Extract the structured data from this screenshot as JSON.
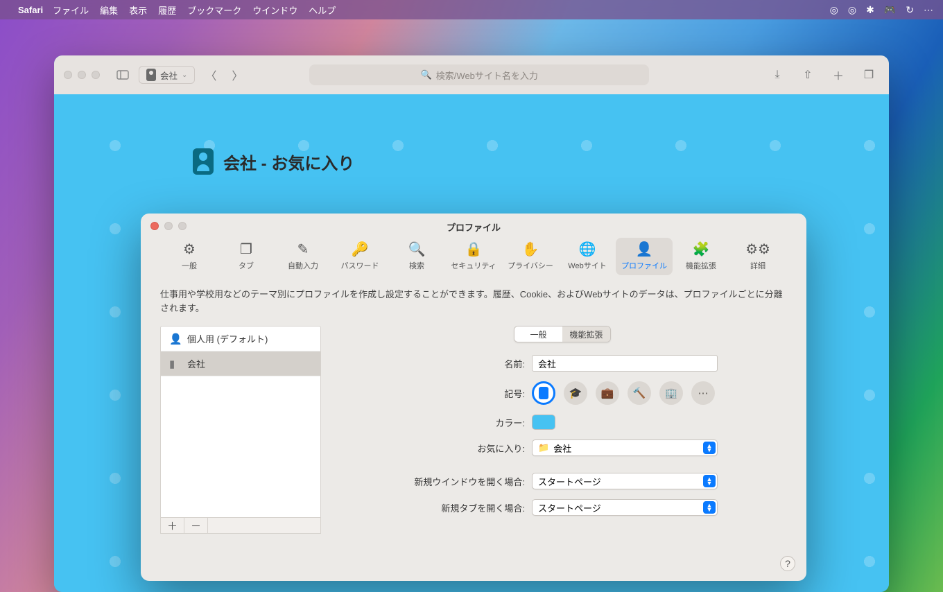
{
  "menubar": {
    "app": "Safari",
    "items": [
      "ファイル",
      "編集",
      "表示",
      "履歴",
      "ブックマーク",
      "ウインドウ",
      "ヘルプ"
    ]
  },
  "safari": {
    "profile_label": "会社",
    "address_placeholder": "検索/Webサイト名を入力",
    "favorites_title": "会社 - お気に入り"
  },
  "prefs": {
    "title": "プロファイル",
    "tabs": [
      {
        "label": "一般",
        "icon": "gear"
      },
      {
        "label": "タブ",
        "icon": "tabs"
      },
      {
        "label": "自動入力",
        "icon": "autofill"
      },
      {
        "label": "パスワード",
        "icon": "key"
      },
      {
        "label": "検索",
        "icon": "search"
      },
      {
        "label": "セキュリティ",
        "icon": "lock"
      },
      {
        "label": "プライバシー",
        "icon": "hand"
      },
      {
        "label": "Webサイト",
        "icon": "globe"
      },
      {
        "label": "プロファイル",
        "icon": "person"
      },
      {
        "label": "機能拡張",
        "icon": "puzzle"
      },
      {
        "label": "詳細",
        "icon": "gears"
      }
    ],
    "description": "仕事用や学校用などのテーマ別にプロファイルを作成し設定することができます。履歴、Cookie、およびWebサイトのデータは、プロファイルごとに分離されます。",
    "profiles": [
      {
        "label": "個人用 (デフォルト)",
        "icon": "person"
      },
      {
        "label": "会社",
        "icon": "badge"
      }
    ],
    "segments": {
      "general": "一般",
      "extensions": "機能拡張"
    },
    "form": {
      "name_label": "名前:",
      "name_value": "会社",
      "symbol_label": "記号:",
      "color_label": "カラー:",
      "favorites_label": "お気に入り:",
      "favorites_value": "会社",
      "new_window_label": "新規ウインドウを開く場合:",
      "new_window_value": "スタートページ",
      "new_tab_label": "新規タブを開く場合:",
      "new_tab_value": "スタートページ"
    },
    "accent": "#0a7aff",
    "profile_color": "#46c2f2"
  }
}
